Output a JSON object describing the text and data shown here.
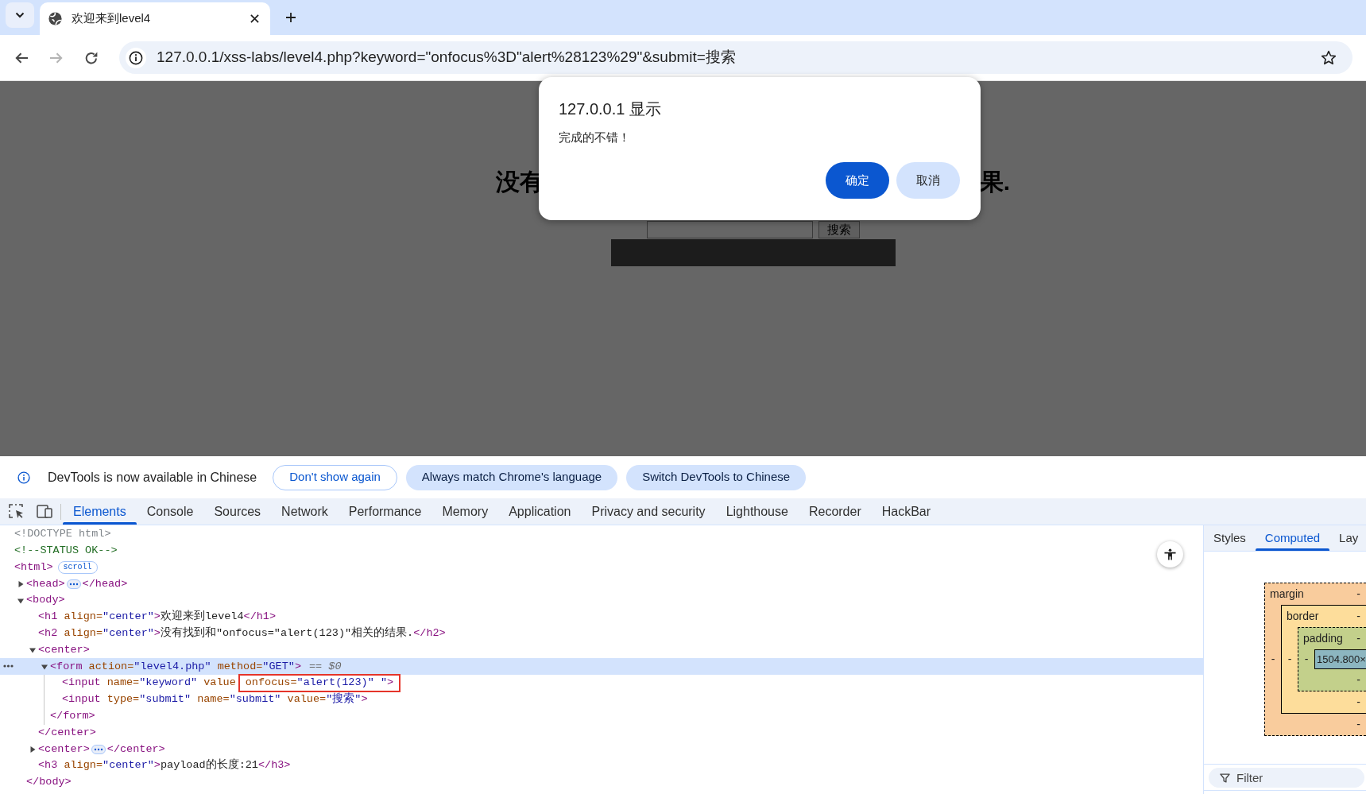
{
  "browser": {
    "tab": {
      "title": "欢迎来到level4",
      "selected": true
    },
    "nav": [
      {
        "kind": "back",
        "disabled": false
      },
      {
        "kind": "forward",
        "disabled": true
      },
      {
        "kind": "reload",
        "disabled": false
      }
    ],
    "address": "127.0.0.1/xss-labs/level4.php?keyword=\"onfocus%3D\"alert%28123%29\"&submit=搜索"
  },
  "page": {
    "heading_left": "没有",
    "heading_right": "果.",
    "submit_label": "搜索"
  },
  "dialog": {
    "title": "127.0.0.1 显示",
    "message": "完成的不错！",
    "buttons": [
      {
        "label": "确定",
        "kind": "primary"
      },
      {
        "label": "取消",
        "kind": "secondary"
      }
    ]
  },
  "devtools": {
    "banner": {
      "message": "DevTools is now available in Chinese",
      "buttons": [
        {
          "label": "Don't show again",
          "kind": "outline"
        },
        {
          "label": "Always match Chrome's language",
          "kind": "tonal"
        },
        {
          "label": "Switch DevTools to Chinese",
          "kind": "tonal"
        }
      ]
    },
    "tabs": [
      {
        "label": "Elements",
        "selected": true
      },
      {
        "label": "Console",
        "selected": false
      },
      {
        "label": "Sources",
        "selected": false
      },
      {
        "label": "Network",
        "selected": false
      },
      {
        "label": "Performance",
        "selected": false
      },
      {
        "label": "Memory",
        "selected": false
      },
      {
        "label": "Application",
        "selected": false
      },
      {
        "label": "Privacy and security",
        "selected": false
      },
      {
        "label": "Lighthouse",
        "selected": false
      },
      {
        "label": "Recorder",
        "selected": false
      },
      {
        "label": "HackBar",
        "selected": false
      }
    ],
    "dom_tree": [
      {
        "selected": false,
        "tokens": [
          {
            "kind": "doctype",
            "text": "<!DOCTYPE html>"
          }
        ]
      },
      {
        "selected": false,
        "tokens": [
          {
            "kind": "comment",
            "text": "<!--STATUS OK-->"
          }
        ]
      },
      {
        "selected": false,
        "tokens": [
          {
            "kind": "tag",
            "text": "<html>"
          }
        ],
        "badge": "scroll",
        "children": [
          {
            "selected": false,
            "expanded": false,
            "tokens": [
              {
                "kind": "tag",
                "text": "<head>"
              }
            ],
            "close": [
              {
                "kind": "tag",
                "text": "</head>"
              }
            ]
          },
          {
            "selected": false,
            "expanded": true,
            "tokens": [
              {
                "kind": "tag",
                "text": "<body>"
              }
            ],
            "children": [
              {
                "selected": false,
                "tokens": [
                  {
                    "kind": "tag",
                    "text": "<h1"
                  },
                  {
                    "kind": "attr",
                    "text": " align="
                  },
                  {
                    "kind": "value",
                    "text": "\"center\""
                  },
                  {
                    "kind": "tag",
                    "text": ">"
                  },
                  {
                    "kind": "text",
                    "text": "欢迎来到level4"
                  },
                  {
                    "kind": "tag",
                    "text": "</h1>"
                  }
                ]
              },
              {
                "selected": false,
                "tokens": [
                  {
                    "kind": "tag",
                    "text": "<h2"
                  },
                  {
                    "kind": "attr",
                    "text": " align="
                  },
                  {
                    "kind": "value",
                    "text": "\"center\""
                  },
                  {
                    "kind": "tag",
                    "text": ">"
                  },
                  {
                    "kind": "text",
                    "text": "没有找到和\"onfocus=\"alert(123)\"相关的结果."
                  },
                  {
                    "kind": "tag",
                    "text": "</h2>"
                  }
                ]
              },
              {
                "selected": false,
                "expanded": true,
                "tokens": [
                  {
                    "kind": "tag",
                    "text": "<center>"
                  }
                ],
                "children": [
                  {
                    "selected": true,
                    "expanded": true,
                    "tokens": [
                      {
                        "kind": "tag",
                        "text": "<form"
                      },
                      {
                        "kind": "attr",
                        "text": " action="
                      },
                      {
                        "kind": "value",
                        "text": "\"level4.php\""
                      },
                      {
                        "kind": "attr",
                        "text": " method="
                      },
                      {
                        "kind": "value",
                        "text": "\"GET\""
                      },
                      {
                        "kind": "tag",
                        "text": ">"
                      }
                    ],
                    "suffix": "== $0",
                    "children": [
                      {
                        "selected": false,
                        "tokens": [
                          {
                            "kind": "tag",
                            "text": "<input"
                          },
                          {
                            "kind": "attr",
                            "text": " name="
                          },
                          {
                            "kind": "value",
                            "text": "\"keyword\""
                          },
                          {
                            "kind": "attr",
                            "text": " value"
                          }
                        ],
                        "boxed": [
                          {
                            "kind": "attr",
                            "text": "onfocus="
                          },
                          {
                            "kind": "value",
                            "text": "\"alert(123)\""
                          },
                          {
                            "kind": "value",
                            "text": " \""
                          },
                          {
                            "kind": "tag",
                            "text": ">"
                          }
                        ]
                      },
                      {
                        "selected": false,
                        "tokens": [
                          {
                            "kind": "tag",
                            "text": "<input"
                          },
                          {
                            "kind": "attr",
                            "text": " type="
                          },
                          {
                            "kind": "value",
                            "text": "\"submit\""
                          },
                          {
                            "kind": "attr",
                            "text": " name="
                          },
                          {
                            "kind": "value",
                            "text": "\"submit\""
                          },
                          {
                            "kind": "attr",
                            "text": " value="
                          },
                          {
                            "kind": "value",
                            "text": "\"搜索\""
                          },
                          {
                            "kind": "tag",
                            "text": ">"
                          }
                        ]
                      }
                    ],
                    "close": [
                      {
                        "kind": "tag",
                        "text": "</form>"
                      }
                    ]
                  }
                ],
                "close": [
                  {
                    "kind": "tag",
                    "text": "</center>"
                  }
                ]
              },
              {
                "selected": false,
                "expanded": false,
                "tokens": [
                  {
                    "kind": "tag",
                    "text": "<center>"
                  }
                ],
                "close": [
                  {
                    "kind": "tag",
                    "text": "</center>"
                  }
                ]
              },
              {
                "selected": false,
                "tokens": [
                  {
                    "kind": "tag",
                    "text": "<h3"
                  },
                  {
                    "kind": "attr",
                    "text": " align="
                  },
                  {
                    "kind": "value",
                    "text": "\"center\""
                  },
                  {
                    "kind": "tag",
                    "text": ">"
                  },
                  {
                    "kind": "text",
                    "text": "payload的长度:21"
                  },
                  {
                    "kind": "tag",
                    "text": "</h3>"
                  }
                ]
              }
            ],
            "close": [
              {
                "kind": "tag",
                "text": "</body>"
              }
            ]
          }
        ]
      }
    ],
    "sidebar": {
      "tabs": [
        {
          "label": "Styles",
          "selected": false
        },
        {
          "label": "Computed",
          "selected": true
        },
        {
          "label": "Lay",
          "selected": false
        }
      ],
      "box_model": {
        "layers": [
          {
            "kind": "margin",
            "label": "margin",
            "top": "-",
            "left": "-"
          },
          {
            "kind": "border",
            "label": "border",
            "top": "-",
            "left": "-"
          },
          {
            "kind": "padding",
            "label": "padding",
            "top": "-",
            "left": "-"
          }
        ],
        "content": "1504.800×",
        "bottoms": [
          "-",
          "-",
          "-"
        ]
      },
      "filter": {
        "placeholder": "Filter"
      }
    }
  }
}
